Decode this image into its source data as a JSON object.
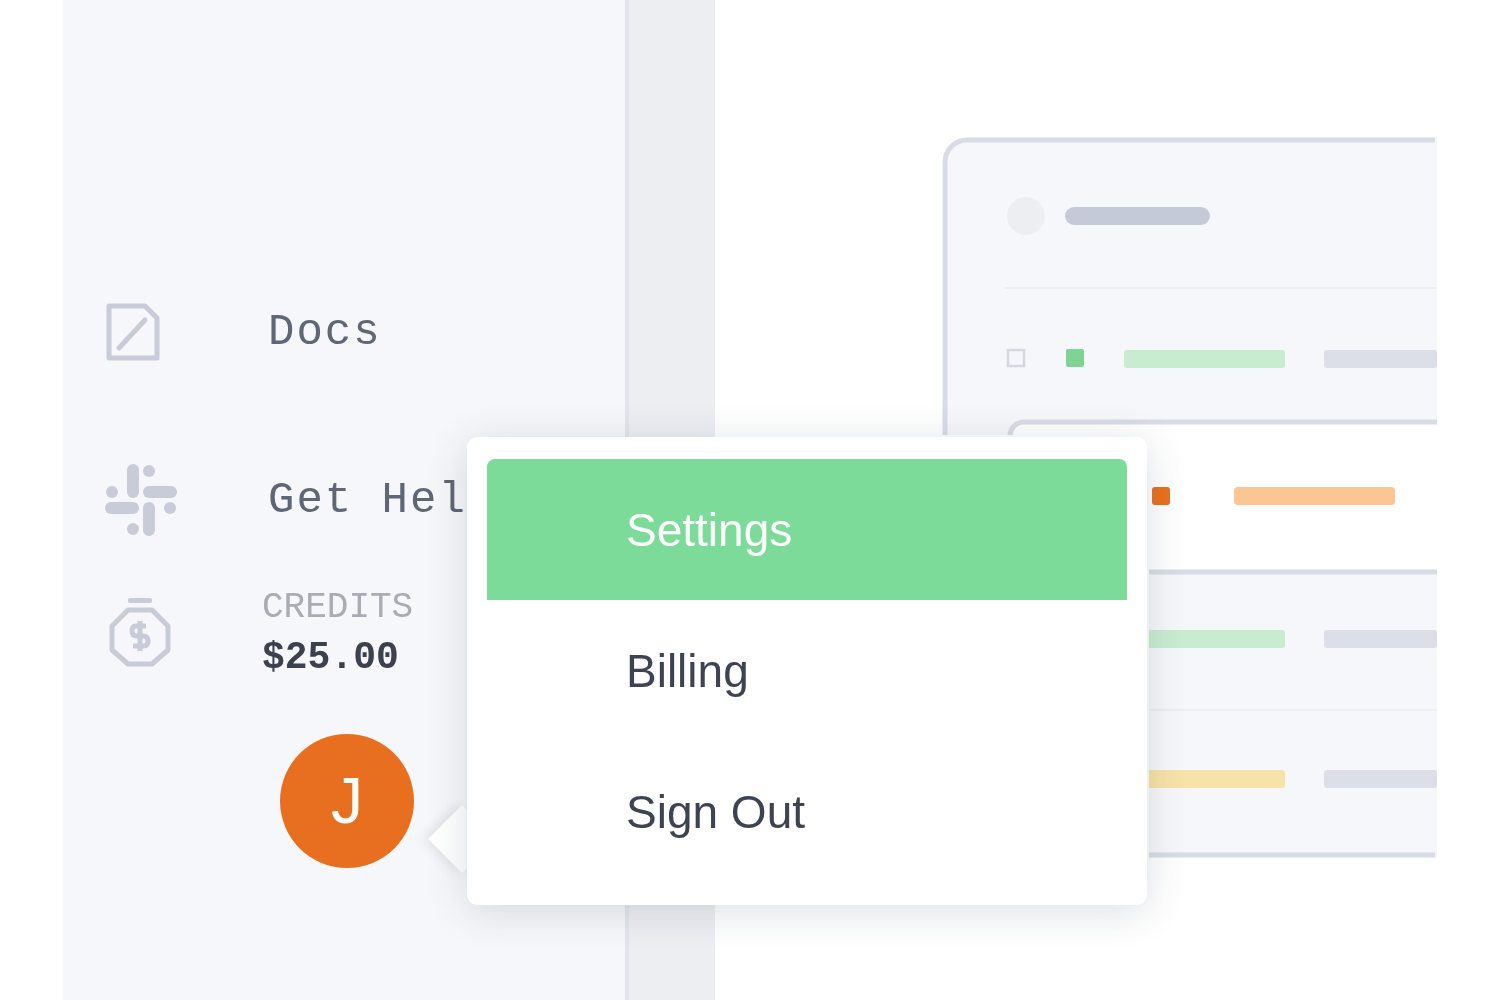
{
  "sidebar": {
    "items": [
      {
        "kind": "docs",
        "label": "Docs"
      },
      {
        "kind": "help",
        "label": "Get Hel"
      }
    ],
    "credits": {
      "label": "CREDITS",
      "amount": "$25.00"
    },
    "avatar": {
      "initial": "J"
    }
  },
  "user_menu": {
    "items": [
      {
        "label": "Settings",
        "selected": true
      },
      {
        "label": "Billing",
        "selected": false
      },
      {
        "label": "Sign Out",
        "selected": false
      }
    ]
  }
}
